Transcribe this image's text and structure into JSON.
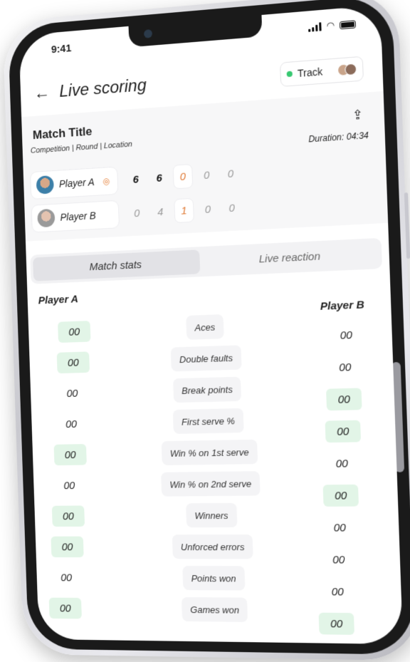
{
  "status_bar": {
    "time": "9:41"
  },
  "header": {
    "title": "Live scoring",
    "track_label": "Track"
  },
  "match": {
    "title": "Match Title",
    "meta": "Competition | Round | Location",
    "duration": "Duration: 04:34",
    "players": [
      {
        "name": "Player A",
        "scores": [
          "6",
          "6",
          "0",
          "0",
          "0"
        ]
      },
      {
        "name": "Player B",
        "scores": [
          "0",
          "4",
          "1",
          "0",
          "0"
        ]
      }
    ]
  },
  "tabs": [
    {
      "label": "Match stats"
    },
    {
      "label": "Live reaction"
    }
  ],
  "stats": {
    "player_a": "Player A",
    "player_b": "Player B",
    "rows": [
      {
        "label": "Aces",
        "a": "00",
        "b": "00",
        "a_win": true,
        "b_win": false
      },
      {
        "label": "Double faults",
        "a": "00",
        "b": "00",
        "a_win": true,
        "b_win": false
      },
      {
        "label": "Break points",
        "a": "00",
        "b": "00",
        "a_win": false,
        "b_win": true
      },
      {
        "label": "First serve %",
        "a": "00",
        "b": "00",
        "a_win": false,
        "b_win": true
      },
      {
        "label": "Win % on 1st serve",
        "a": "00",
        "b": "00",
        "a_win": true,
        "b_win": false
      },
      {
        "label": "Win % on 2nd serve",
        "a": "00",
        "b": "00",
        "a_win": false,
        "b_win": true
      },
      {
        "label": "Winners",
        "a": "00",
        "b": "00",
        "a_win": true,
        "b_win": false
      },
      {
        "label": "Unforced errors",
        "a": "00",
        "b": "00",
        "a_win": true,
        "b_win": false
      },
      {
        "label": "Points won",
        "a": "00",
        "b": "00",
        "a_win": false,
        "b_win": false
      },
      {
        "label": "Games won",
        "a": "00",
        "b": "00",
        "a_win": true,
        "b_win": true
      }
    ]
  },
  "colors": {
    "win_bg": "#e2f5e7",
    "live_dot": "#37c871",
    "live_score": "#e07a35"
  }
}
